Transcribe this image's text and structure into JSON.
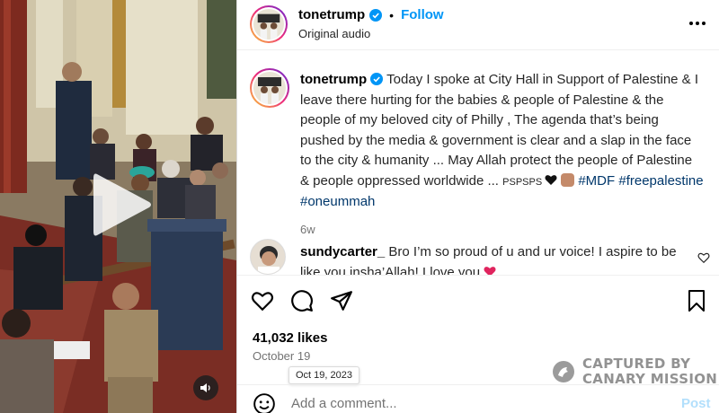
{
  "post": {
    "username": "tonetrump",
    "follow_label": "Follow",
    "audio_label": "Original audio",
    "separator": "•"
  },
  "caption": {
    "username": "tonetrump",
    "text": "Today I spoke at City Hall in Support of Palestine & I leave there hurting for the babies & people of Palestine & the people of my beloved city of Philly , The agenda that’s being pushed by the media & government is clear and a slap in the face to the city & humanity ... May Allah protect the people of Palestine & people oppressed worldwide ... ",
    "psps": "PSPSPS",
    "hashtags": [
      "#MDF",
      "#freepalestine",
      "#oneummah"
    ],
    "time": "6w"
  },
  "comment": {
    "username": "sundycarter_",
    "text": "Bro I’m so proud of u and ur voice! I aspire to be like you insha’Allah! I love you"
  },
  "engagement": {
    "likes": "41,032 likes",
    "date": "October 19",
    "date_tooltip": "Oct 19, 2023"
  },
  "composer": {
    "placeholder": "Add a comment...",
    "post_label": "Post"
  },
  "watermark": {
    "line1": "CAPTURED BY",
    "line2": "CANARY MISSION"
  },
  "icons": {
    "verified": "verified-badge-icon",
    "more": "more-options-icon",
    "like": "heart-outline-icon",
    "comment": "comment-bubble-icon",
    "share": "paper-plane-icon",
    "save": "bookmark-icon",
    "emoji": "smiley-icon",
    "play": "play-icon",
    "mute": "speaker-icon"
  },
  "colors": {
    "accent": "#0095f6",
    "verified": "#0095f6",
    "hashtag": "#00376b",
    "muted_text": "#737373",
    "post_disabled": "#b2dffc"
  }
}
